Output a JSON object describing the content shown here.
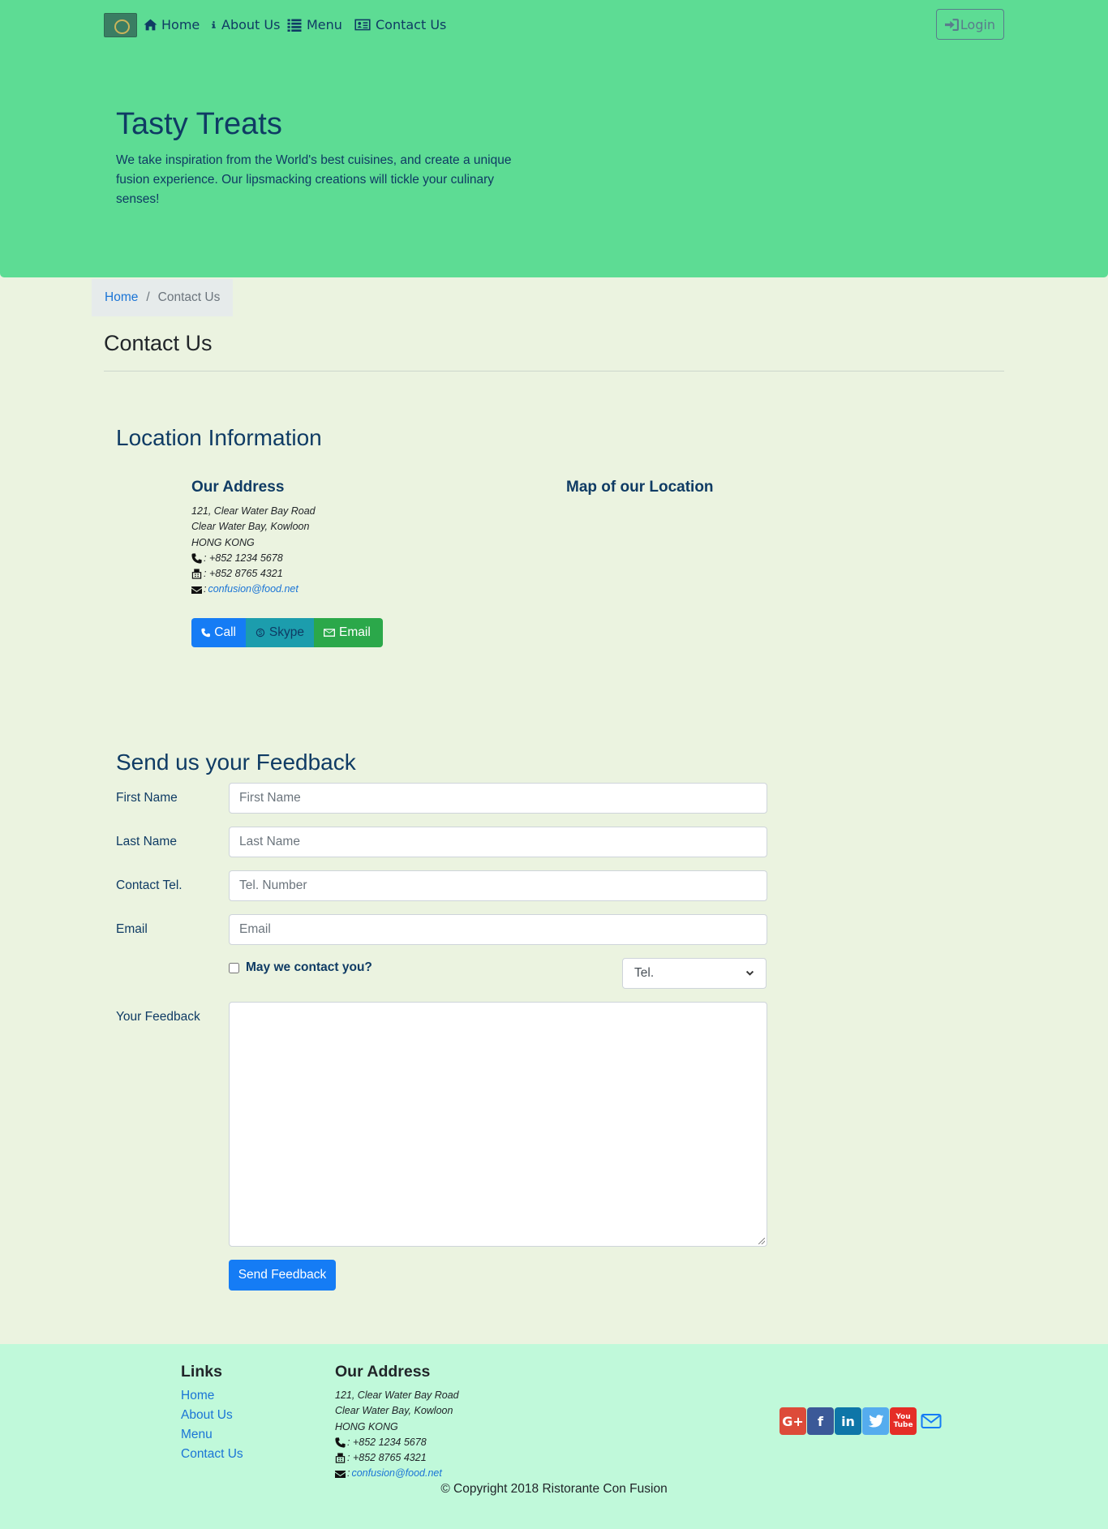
{
  "nav": {
    "brand_icon": "restaurant-logo",
    "items": [
      {
        "label": "Home",
        "icon": "home-icon"
      },
      {
        "label": "About Us",
        "icon": "info-icon"
      },
      {
        "label": "Menu",
        "icon": "list-icon"
      },
      {
        "label": "Contact Us",
        "icon": "address-card-icon"
      }
    ],
    "login_label": "Login"
  },
  "jumbotron": {
    "title": "Tasty Treats",
    "text": "We take inspiration from the World's best cuisines, and create a unique fusion experience. Our lipsmacking creations will tickle your culinary senses!"
  },
  "breadcrumb": {
    "home": "Home",
    "separator": "/",
    "active": "Contact Us"
  },
  "page_title": "Contact Us",
  "location": {
    "title": "Location Information",
    "address_heading": "Our Address",
    "map_heading": "Map of our Location",
    "address_lines": [
      "121, Clear Water Bay Road",
      "Clear Water Bay, Kowloon",
      "HONG KONG"
    ],
    "phone": ": +852 1234 5678",
    "fax": ": +852 8765 4321",
    "email_prefix": ":",
    "email": "confusion@food.net",
    "buttons": {
      "call": "Call",
      "skype": "Skype",
      "email": "Email"
    }
  },
  "feedback": {
    "title": "Send us your Feedback",
    "first_name_label": "First Name",
    "first_name_placeholder": "First Name",
    "last_name_label": "Last Name",
    "last_name_placeholder": "Last Name",
    "tel_label": "Contact Tel.",
    "tel_placeholder": "Tel. Number",
    "email_label": "Email",
    "email_placeholder": "Email",
    "contact_check_label": "May we contact you?",
    "contact_method_selected": "Tel.",
    "feedback_label": "Your Feedback",
    "submit_label": "Send Feedback"
  },
  "footer": {
    "links_heading": "Links",
    "links": [
      "Home",
      "About Us",
      "Menu",
      "Contact Us"
    ],
    "address_heading": "Our Address",
    "address_lines": [
      "121, Clear Water Bay Road",
      "Clear Water Bay, Kowloon",
      "HONG KONG"
    ],
    "phone": ": +852 1234 5678",
    "fax": ": +852 8765 4321",
    "email_prefix": ":",
    "email": "confusion@food.net",
    "social": [
      "google-plus-icon",
      "facebook-icon",
      "linkedin-icon",
      "twitter-icon",
      "youtube-icon",
      "envelope-icon"
    ],
    "copyright": "© Copyright 2018 Ristorante Con Fusion"
  },
  "colors": {
    "nav_bg": "#5ddc94",
    "page_bg": "#ebf3e0",
    "footer_bg": "#c0f9da",
    "primary": "#157cf5",
    "info": "#1c9dad",
    "success": "#2ba84a",
    "heading": "#0f3b64"
  }
}
